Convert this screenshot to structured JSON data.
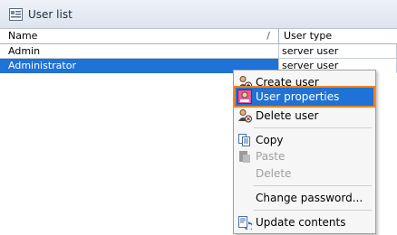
{
  "window": {
    "title": "User list"
  },
  "table": {
    "columns": [
      "Name",
      "User type"
    ],
    "sort_indicator": "/",
    "rows": [
      {
        "name": "Admin",
        "type": "server user"
      },
      {
        "name": "Administrator",
        "type": "server user"
      }
    ]
  },
  "context_menu": {
    "items": [
      {
        "label": "Create user",
        "icon": "create-user-icon",
        "enabled": true
      },
      {
        "label": "User properties",
        "icon": "user-properties-icon",
        "enabled": true,
        "highlighted": true
      },
      {
        "label": "Delete user",
        "icon": "delete-user-icon",
        "enabled": true
      },
      {
        "label": "Copy",
        "icon": "copy-icon",
        "enabled": true
      },
      {
        "label": "Paste",
        "icon": "paste-icon",
        "enabled": false
      },
      {
        "label": "Delete",
        "icon": "",
        "enabled": false
      },
      {
        "label": "Change password...",
        "icon": "",
        "enabled": true
      },
      {
        "label": "Update contents",
        "icon": "refresh-icon",
        "enabled": true
      }
    ]
  },
  "colors": {
    "selection": "#1f72d6",
    "highlight_outline": "#f0821e"
  }
}
